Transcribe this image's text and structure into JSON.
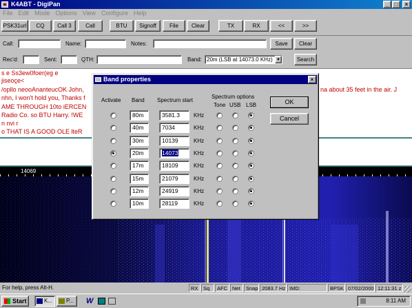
{
  "window": {
    "title": "K4ABT - DigiPan"
  },
  "menu": [
    "File",
    "Edit",
    "Mode",
    "Options",
    "View",
    "Configure",
    "Help"
  ],
  "toolbar": [
    "PSK31url",
    "CQ",
    "Call 3",
    "Call",
    "BTU",
    "Signoff",
    "File",
    "Clear",
    "TX",
    "RX",
    "<<",
    ">>"
  ],
  "callrow": {
    "call_label": "Call:",
    "call_value": "",
    "name_label": "Name:",
    "name_value": "",
    "notes_label": "Notes:",
    "notes_value": "",
    "save": "Save",
    "clear": "Clear"
  },
  "recrow": {
    "recd_label": "Rec'd:",
    "recd_value": "",
    "sent_label": "Sent:",
    "sent_value": "",
    "qth_label": "QTH:",
    "qth_value": "",
    "band_label": "Band:",
    "band_value": "20m (LSB at 14073.0 KHz)",
    "search": "Search"
  },
  "rx_lines": [
    "s  e   Ss3ew0foer(eg e",
    "  jiseoçe<",
    "/opllo neooAnanteucOK John,",
    "nhn, I won't hold you, Thanks f",
    "AME THROUGH 10to iERCEN",
    "Radio Co. so BTU Harry. !WE",
    " n nvi   r",
    "o THAT IS A GOOD OLE   lteR"
  ],
  "rx_right_line": "na about 35 feet in the air.  J",
  "scale_label": "14069",
  "status": {
    "help": "For help, press Alt-H.",
    "rx": "RX",
    "sq": "Sq",
    "afc": "AFC",
    "net": "Net",
    "snap": "Snap",
    "freq": "2083.7 Hz",
    "imd": "IMD:",
    "mode": "BPSK",
    "date": "07/02/2000",
    "time": "12:11:31 z"
  },
  "taskbar": {
    "start": "Start",
    "task1": "K...",
    "task2": "P...",
    "clock": "8:11 AM"
  },
  "dialog": {
    "title": "Band properties",
    "col_activate": "Activate",
    "col_band": "Band",
    "col_spectrum_start": "Spectrum start",
    "col_spectrum_options": "Spectrum options",
    "col_tone": "Tone",
    "col_usb": "USB",
    "col_lsb": "LSB",
    "unit": "KHz",
    "ok": "OK",
    "cancel": "Cancel",
    "rows": [
      {
        "band": "80m",
        "start": "3581.3",
        "active": false
      },
      {
        "band": "40m",
        "start": "7034",
        "active": false
      },
      {
        "band": "30m",
        "start": "10139",
        "active": false
      },
      {
        "band": "20m",
        "start": "14073",
        "active": true
      },
      {
        "band": "17m",
        "start": "18109",
        "active": false
      },
      {
        "band": "15m",
        "start": "21079",
        "active": false
      },
      {
        "band": "12m",
        "start": "24919",
        "active": false
      },
      {
        "band": "10m",
        "start": "28119",
        "active": false
      }
    ]
  }
}
